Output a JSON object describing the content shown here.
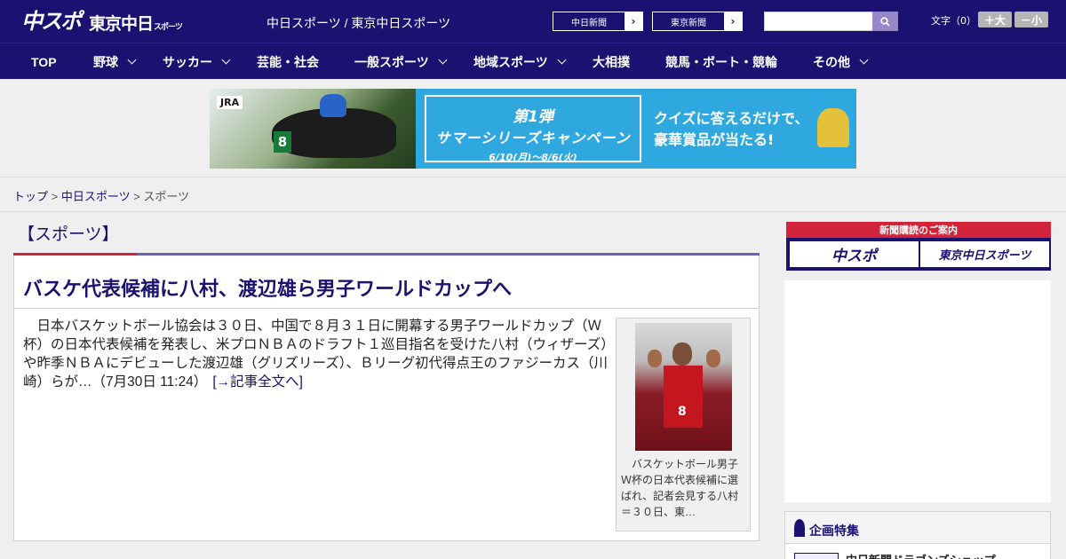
{
  "header": {
    "logo_chunichi": "中スポ",
    "logo_tokyo": "東京中日",
    "logo_tokyo_small": "スポーツ",
    "site_title": "中日スポーツ / 東京中日スポーツ",
    "paper_buttons": [
      {
        "label": "中日新聞"
      },
      {
        "label": "東京新聞"
      }
    ],
    "search_placeholder": "",
    "font_size_label": "文字（0）",
    "font_larger": "＋大",
    "font_smaller": "－小"
  },
  "nav": {
    "items": [
      {
        "label": "TOP",
        "has_dropdown": false
      },
      {
        "label": "野球",
        "has_dropdown": true
      },
      {
        "label": "サッカー",
        "has_dropdown": true
      },
      {
        "label": "芸能・社会",
        "has_dropdown": false
      },
      {
        "label": "一般スポーツ",
        "has_dropdown": true
      },
      {
        "label": "地域スポーツ",
        "has_dropdown": true
      },
      {
        "label": "大相撲",
        "has_dropdown": false
      },
      {
        "label": "競馬・ボート・競輪",
        "has_dropdown": false
      },
      {
        "label": "その他",
        "has_dropdown": true
      }
    ]
  },
  "banner": {
    "sponsor": "JRA",
    "saddle_number": "8",
    "headline_1": "第1弾",
    "headline_2": "サマーシリーズキャンペーン",
    "dates": "6/10(月)～8/6(火)",
    "copy_line_1": "クイズに答えるだけで、",
    "copy_line_2": "豪華賞品が当たる!"
  },
  "breadcrumb": {
    "home": "トップ",
    "sep": " > ",
    "parent": "中日スポーツ",
    "current": "スポーツ"
  },
  "section": {
    "heading": "【スポーツ】"
  },
  "article": {
    "title": "バスケ代表候補に八村、渡辺雄ら男子ワールドカップへ",
    "body": "　日本バスケットボール協会は３０日、中国で８月３１日に開幕する男子ワールドカップ（Ｗ杯）の日本代表候補を発表し、米プロＮＢＡのドラフト１巡目指名を受けた八村（ウィザーズ）や昨季ＮＢＡにデビューした渡辺雄（グリズリーズ）、Ｂリーグ初代得点王のファジーカス（川崎）らが…（7月30日 11:24）",
    "more_link": "[→記事全文へ]",
    "photo_jersey_number": "8",
    "photo_caption": "　バスケットボール男子Ｗ杯の日本代表候補に選ばれ、記者会見する八村＝３０日、東…"
  },
  "sidebar": {
    "subscribe_heading": "新聞購読のご案内",
    "subscribe_tile_1": "中スポ",
    "subscribe_tile_2": "東京中日スポーツ",
    "feature_heading": "企画特集",
    "feature_item_1": "中日新聞ドラゴンズショップ"
  },
  "colors": {
    "brand_navy": "#1a1170",
    "accent_red": "#d1243a",
    "accent_purple": "#6f5fb3"
  }
}
